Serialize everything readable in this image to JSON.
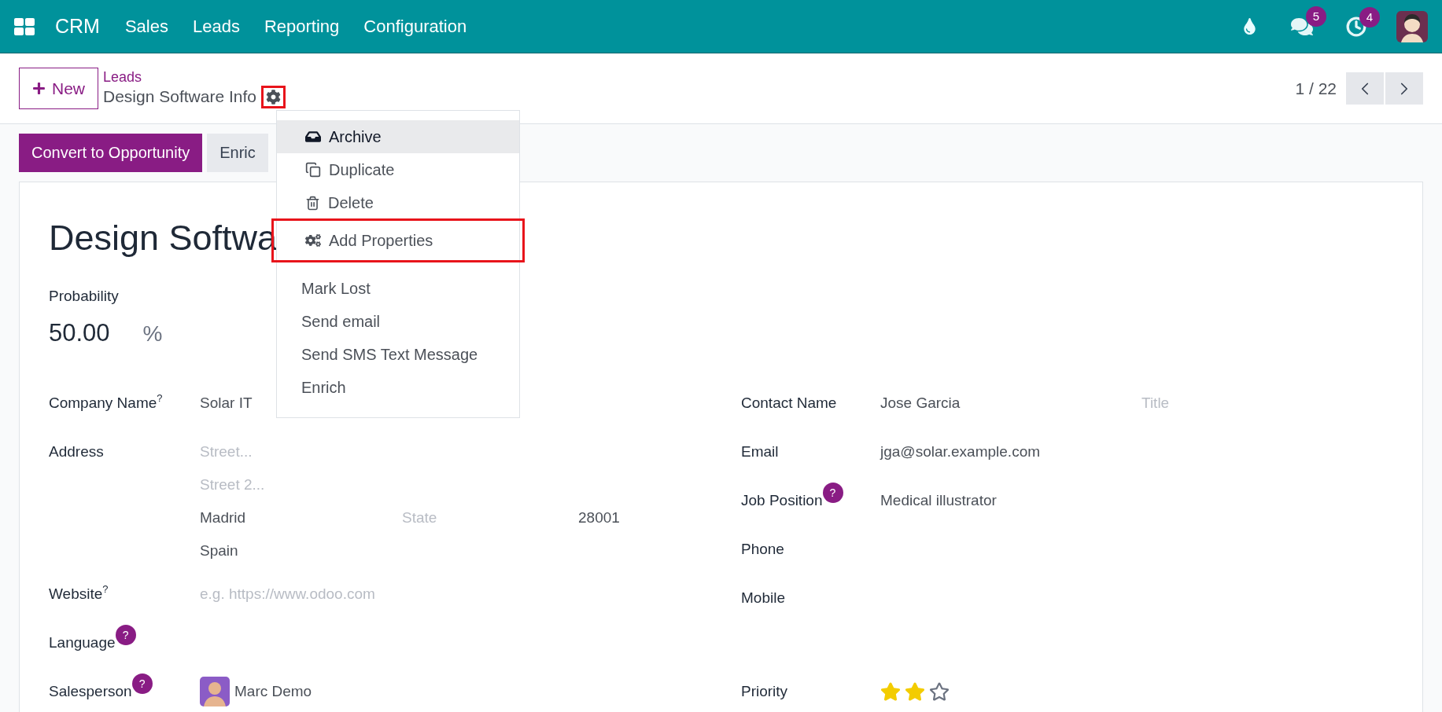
{
  "navbar": {
    "app": "CRM",
    "menus": [
      "Sales",
      "Leads",
      "Reporting",
      "Configuration"
    ],
    "messages_badge": "5",
    "activities_badge": "4"
  },
  "new_button": "New",
  "breadcrumb": {
    "parent": "Leads",
    "current": "Design Software Info",
    "gear_annotated": true
  },
  "pager": {
    "text": "1 / 22"
  },
  "actions": [
    {
      "label": "Convert to Opportunity",
      "kind": "primary"
    },
    {
      "label": "Enric",
      "kind": "secondary"
    }
  ],
  "menu": {
    "groups": [
      [
        {
          "label": "Archive",
          "kind": "archive",
          "hover": true,
          "annotated": false
        },
        {
          "label": "Duplicate",
          "kind": "duplicate",
          "hover": false,
          "annotated": false
        },
        {
          "label": "Delete",
          "kind": "delete",
          "hover": false,
          "annotated": false
        },
        {
          "label": "Add Properties",
          "kind": "properties",
          "hover": false,
          "annotated": true
        }
      ],
      [
        {
          "label": "Mark Lost",
          "kind": "plain",
          "hover": false,
          "annotated": false
        },
        {
          "label": "Send email",
          "kind": "plain",
          "hover": false,
          "annotated": false
        },
        {
          "label": "Send SMS Text Message",
          "kind": "plain",
          "hover": false,
          "annotated": false
        },
        {
          "label": "Enrich",
          "kind": "plain",
          "hover": false,
          "annotated": false
        }
      ]
    ]
  },
  "form": {
    "title": "Design Softwa",
    "probability": {
      "label": "Probability",
      "value": "50.00",
      "unit": "%"
    },
    "left": [
      {
        "kind": "field",
        "label": "Company Name",
        "help": {
          "kind": "superscript",
          "text": "?"
        },
        "value": "Solar IT"
      },
      {
        "kind": "address",
        "label": "Address",
        "street": {
          "placeholder": "Street..."
        },
        "street2": {
          "placeholder": "Street 2..."
        },
        "city": {
          "value": "Madrid"
        },
        "state": {
          "placeholder": "State"
        },
        "zip": {
          "value": "28001"
        },
        "country": {
          "value": "Spain"
        }
      },
      {
        "kind": "field",
        "label": "Website",
        "help": {
          "kind": "superscript",
          "text": "?"
        },
        "placeholder": "e.g. https://www.odoo.com"
      },
      {
        "kind": "field",
        "label": "Language",
        "help": {
          "kind": "badge",
          "text": "?"
        }
      },
      {
        "kind": "user",
        "label": "Salesperson",
        "help": {
          "kind": "badge",
          "text": "?"
        },
        "value": "Marc Demo"
      }
    ],
    "right": [
      {
        "kind": "contact",
        "label": "Contact Name",
        "value": "Jose Garcia",
        "title_placeholder": "Title"
      },
      {
        "kind": "field",
        "label": "Email",
        "value": "jga@solar.example.com"
      },
      {
        "kind": "field",
        "label": "Job Position",
        "help": {
          "kind": "badge",
          "text": "?"
        },
        "value": "Medical illustrator"
      },
      {
        "kind": "field",
        "label": "Phone"
      },
      {
        "kind": "field",
        "label": "Mobile"
      },
      {
        "kind": "stars",
        "label": "Priority",
        "stars": 2
      }
    ]
  }
}
